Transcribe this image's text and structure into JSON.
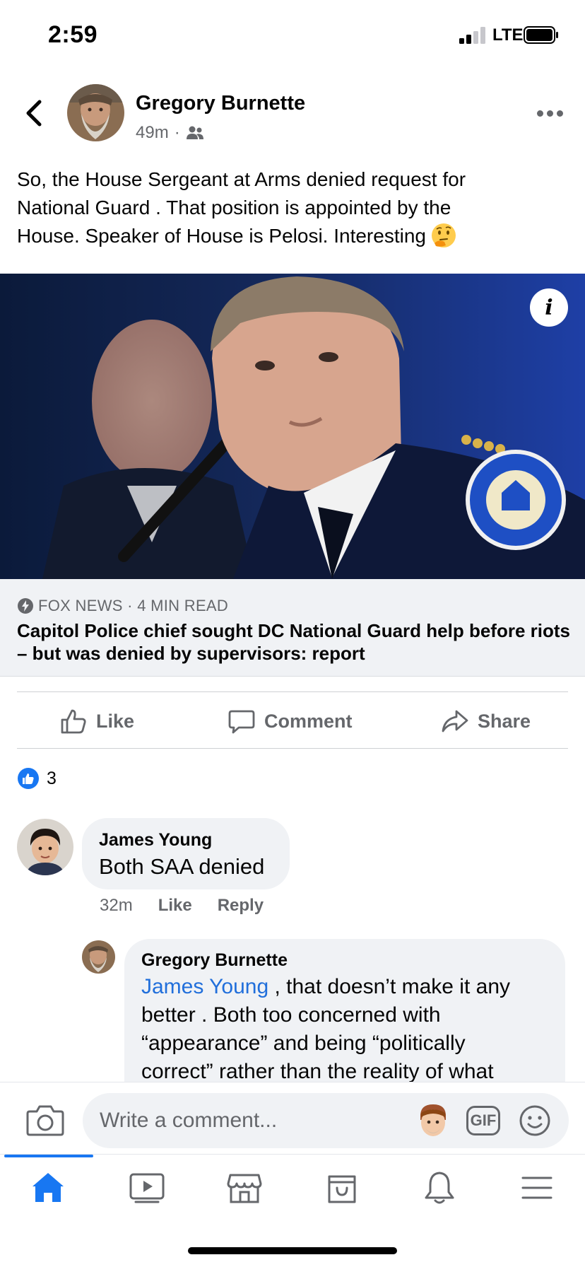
{
  "status_bar": {
    "time": "2:59",
    "network": "LTE"
  },
  "post": {
    "author": "Gregory Burnette",
    "time_ago": "49m",
    "meta_separator": "·",
    "text_lines": [
      "So, the House Sergeant at Arms denied request for",
      "National Guard . That position is appointed by the",
      "House. Speaker of House is Pelosi.   Interesting"
    ],
    "icons": {
      "back": "chevron-left-icon",
      "audience": "friends-icon",
      "more": "more-dots-icon",
      "emoji": "thinking-face-emoji"
    }
  },
  "link_preview": {
    "source": "FOX NEWS · 4 MIN READ",
    "title": "Capitol Police chief sought DC National Guard help before riots – but was denied by supervisors: report",
    "info_label": "i"
  },
  "actions": {
    "like": "Like",
    "comment": "Comment",
    "share": "Share"
  },
  "reactions": {
    "count": "3"
  },
  "comments": [
    {
      "author": "James Young",
      "text": "Both SAA denied",
      "time_ago": "32m",
      "like": "Like",
      "reply": "Reply"
    }
  ],
  "reply": {
    "author": "Gregory Burnette",
    "mention": "James Young",
    "text_first_line": " , that doesn’t make it any",
    "text_lines": [
      "better .  Both too concerned with",
      "“appearance” and being “politically",
      "correct” rather than the reality of what"
    ]
  },
  "composer": {
    "placeholder": "Write a comment...",
    "gif_label": "GIF"
  },
  "tab_bar": {
    "tabs": [
      "home-icon",
      "watch-icon",
      "marketplace-icon",
      "shop-icon",
      "notifications-icon",
      "menu-icon"
    ],
    "active": "home-icon"
  },
  "colors": {
    "brand_blue": "#1877f2",
    "mention_blue": "#216fdb",
    "secondary_text": "#65676b",
    "bubble_gray": "#f0f2f5"
  }
}
